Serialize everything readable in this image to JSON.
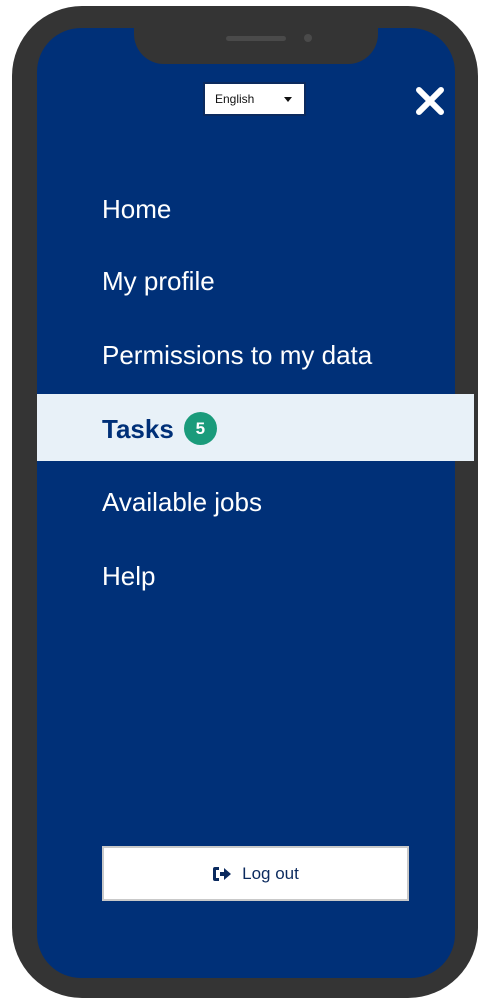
{
  "language_select": {
    "selected": "English",
    "icon": "chevron-down-icon"
  },
  "close_button": {
    "icon": "close-icon"
  },
  "nav": {
    "items": [
      {
        "label": "Home"
      },
      {
        "label": "My profile"
      },
      {
        "label": "Permissions to my data"
      },
      {
        "label": "Tasks",
        "badge": "5",
        "active": true
      },
      {
        "label": "Available jobs"
      },
      {
        "label": "Help"
      }
    ]
  },
  "logout": {
    "label": "Log out",
    "icon": "logout-icon"
  },
  "colors": {
    "background": "#003078",
    "active_bg": "#e8f1f8",
    "badge": "#1a9b7b",
    "frame": "#343434"
  }
}
